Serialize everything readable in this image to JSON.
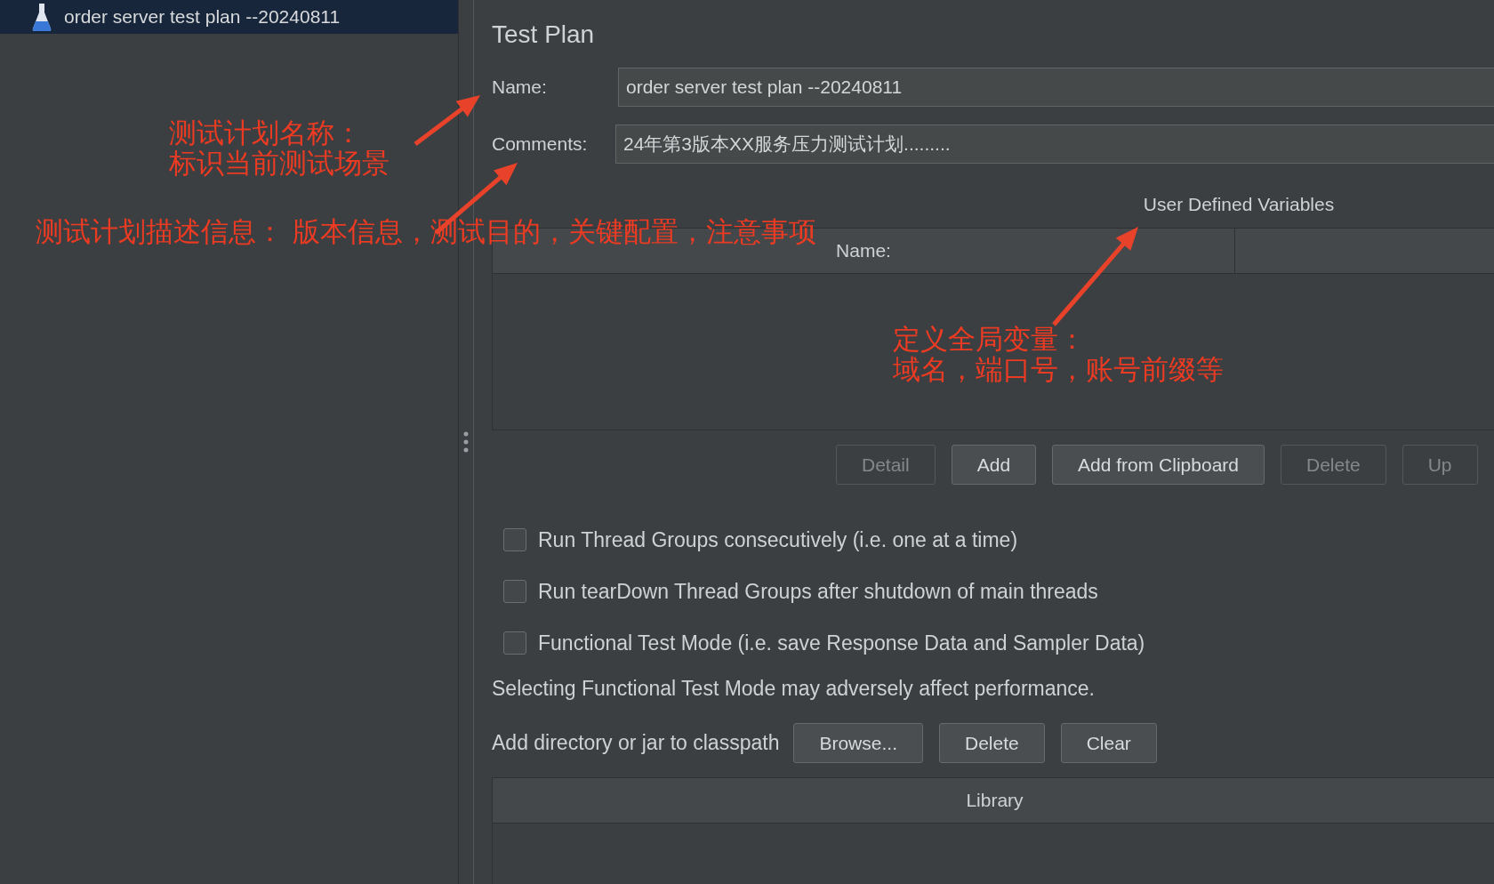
{
  "tree": {
    "items": [
      {
        "label": "order server test plan --20240811",
        "selected": true
      }
    ]
  },
  "panel": {
    "title": "Test Plan",
    "fields": [
      {
        "label": "Name:",
        "value": "order server test plan --20240811"
      },
      {
        "label": "Comments:",
        "value": "24年第3版本XX服务压力测试计划........."
      }
    ],
    "variables": {
      "title": "User Defined Variables",
      "columns": [
        "Name:"
      ]
    },
    "buttons": [
      {
        "label": "Detail",
        "disabled": true
      },
      {
        "label": "Add",
        "disabled": false
      },
      {
        "label": "Add from Clipboard",
        "disabled": false
      },
      {
        "label": "Delete",
        "disabled": true
      },
      {
        "label": "Up",
        "disabled": true
      }
    ],
    "options": [
      {
        "label": "Run Thread Groups consecutively (i.e. one at a time)",
        "checked": false
      },
      {
        "label": "Run tearDown Thread Groups after shutdown of main threads",
        "checked": false
      },
      {
        "label": "Functional Test Mode (i.e. save Response Data and Sampler Data)",
        "checked": false
      }
    ],
    "note": "Selecting Functional Test Mode may adversely affect performance.",
    "classpath": {
      "label": "Add directory or jar to classpath",
      "buttons": [
        {
          "label": "Browse...",
          "disabled": false
        },
        {
          "label": "Delete",
          "disabled": false
        },
        {
          "label": "Clear",
          "disabled": false
        }
      ],
      "columns": [
        "Library"
      ]
    }
  },
  "annotations": [
    {
      "lines": [
        "测试计划名称：",
        "标识当前测试场景"
      ]
    },
    {
      "lines": [
        "测试计划描述信息：  版本信息，测试目的，关键配置，注意事项"
      ]
    },
    {
      "lines": [
        "定义全局变量：",
        "域名，端口号，账号前缀等"
      ]
    }
  ]
}
